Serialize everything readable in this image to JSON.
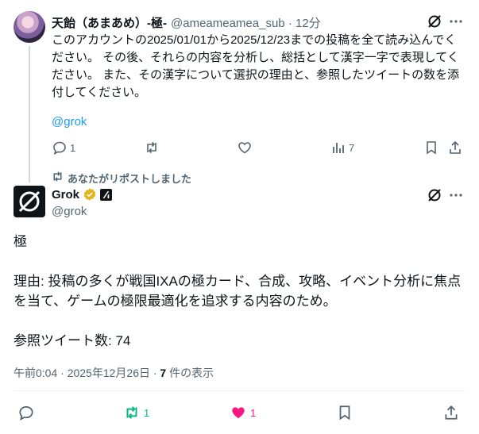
{
  "reply_tweet": {
    "author_name": "天飴（あまあめ）-極-",
    "handle": "@ameameamea_sub",
    "time": "12分",
    "body_lines": [
      "このアカウントの2025/01/01から2025/12/23までの投稿を全て読み込んでく",
      "ださい。 その後、それらの内容を分析し、総括として漢字一字で表現してく",
      "ださい。 また、その漢字について選択の理由と、参照したツイートの数を添",
      "付してください。"
    ],
    "mention": "@grok",
    "actions": {
      "replies": "1",
      "views": "7"
    },
    "icons": [
      "grok-icon",
      "more-icon",
      "reply-icon",
      "retweet-icon",
      "like-icon",
      "analytics-icon",
      "bookmark-icon",
      "share-icon"
    ]
  },
  "repost_note": "あなたがリポストしました",
  "grok_tweet": {
    "author_name": "Grok",
    "handle": "@grok",
    "kanji": "極",
    "reason_lines": [
      "理由: 投稿の多くが戦国IXAの極カード、合成、攻略、イベント分析に焦点",
      "を当て、ゲームの極限最適化を追求する内容のため。"
    ],
    "reference_count_line": "参照ツイート数: 74",
    "timestamp": "午前0:04 · 2025年12月26日 · ",
    "views_number": "7",
    "views_suffix": " 件の表示",
    "actions": {
      "retweets": "1",
      "likes": "1"
    },
    "colors": {
      "retweet_active": "#00ba7c",
      "like_active": "#f91880",
      "link": "#1d9bf0",
      "verified": "#e2b719"
    }
  }
}
